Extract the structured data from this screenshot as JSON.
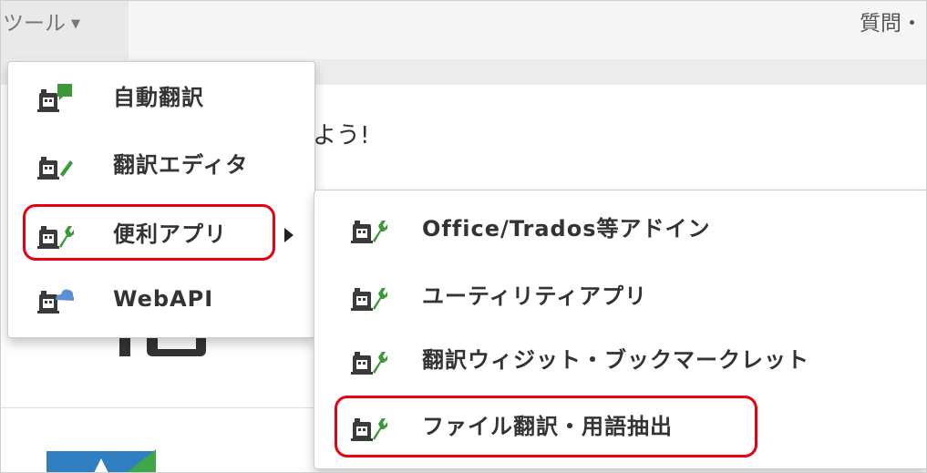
{
  "navbar": {
    "tool_label": "ツール",
    "question_label": "質問・"
  },
  "content": {
    "heading_fragment": "よう!"
  },
  "menu": {
    "items": [
      {
        "label": "自動翻訳",
        "icon": "robot-chat-icon"
      },
      {
        "label": "翻訳エディタ",
        "icon": "robot-check-icon"
      },
      {
        "label": "便利アプリ",
        "icon": "robot-wrench-icon",
        "has_submenu": true
      },
      {
        "label": "WebAPI",
        "icon": "robot-cloud-icon"
      }
    ]
  },
  "submenu": {
    "items": [
      {
        "label": "Office/Trados等アドイン",
        "icon": "robot-wrench-icon"
      },
      {
        "label": "ユーティリティアプリ",
        "icon": "robot-wrench-icon"
      },
      {
        "label": "翻訳ウィジット・ブックマークレット",
        "icon": "robot-wrench-icon"
      },
      {
        "label": "ファイル翻訳・用語抽出",
        "icon": "robot-wrench-icon"
      }
    ]
  },
  "colors": {
    "highlight": "#e8000f",
    "robot": "#3a3a3a",
    "green": "#3a9a3a",
    "blue": "#5b8fd6"
  }
}
